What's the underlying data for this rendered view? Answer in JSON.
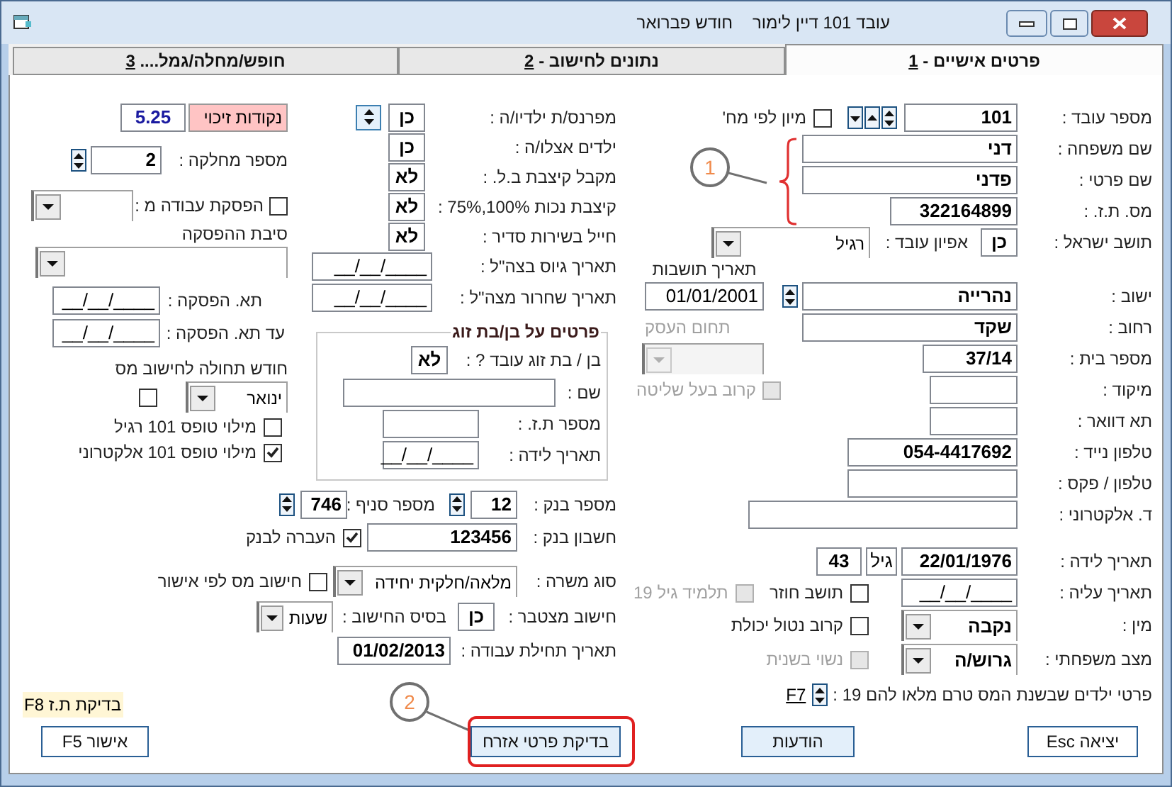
{
  "window": {
    "month": "חודש פברואר",
    "title": "עובד 101 דיין לימור"
  },
  "tabs": [
    {
      "label": "פרטים אישיים - ",
      "hotkey": "1",
      "selected": true
    },
    {
      "label": "נתונים לחישוב - ",
      "hotkey": "2",
      "selected": false
    },
    {
      "label": "חופש/מחלה/גמל.... ",
      "hotkey": "3",
      "selected": false
    }
  ],
  "personal": {
    "employee_number": {
      "label": "מספר עובד :",
      "value": "101"
    },
    "sort_by_department": {
      "label": "מיון לפי מח'",
      "checked": false
    },
    "last_name": {
      "label": "שם משפחה :",
      "value": "דני"
    },
    "first_name": {
      "label": "שם פרטי :",
      "value": "פדני"
    },
    "id_number": {
      "label": "מס. ת.ז. :",
      "value": "322164899"
    },
    "israeli_resident": {
      "label": "תושב ישראל :",
      "value": "כן"
    },
    "employee_type": {
      "label": "אפיון עובד :",
      "value": "רגיל"
    },
    "residence_date": {
      "label": "תאריך תושבות",
      "value": "01/01/2001"
    },
    "city": {
      "label": "ישוב :",
      "value": "נהרייה"
    },
    "street": {
      "label": "רחוב :",
      "value": "שקד"
    },
    "business_field": {
      "label": "תחום העסק",
      "disabled": true
    },
    "house_number": {
      "label": "מספר בית :",
      "value": "37/14"
    },
    "zip": {
      "label": "מיקוד :"
    },
    "controlling_relative": {
      "label": "קרוב בעל שליטה",
      "checked": false,
      "disabled": true
    },
    "po_box": {
      "label": "תא דוואר :"
    },
    "mobile": {
      "label": "טלפון נייד :",
      "value": "054-4417692"
    },
    "phone_fax": {
      "label": "טלפון / פקס :"
    },
    "email": {
      "label": "ד. אלקטרוני :"
    },
    "birth_date": {
      "label": "תאריך לידה :",
      "value": "22/01/1976"
    },
    "age": {
      "label": "גיל",
      "value": "43"
    },
    "immigration_date": {
      "label": "תאריך עליה :",
      "value": "__/__/____"
    },
    "returning_resident": {
      "label": "תושב חוזר",
      "checked": false,
      "disabled": false
    },
    "student_19": {
      "label": "תלמיד גיל 19",
      "checked": false,
      "disabled": true
    },
    "gender": {
      "label": "מין :",
      "value": "נקבה"
    },
    "disabled_relative": {
      "label": "קרוב נטול יכולת",
      "checked": false,
      "disabled": false
    },
    "marital_status": {
      "label": "מצב משפחתי :",
      "value": "גרוש/ה"
    },
    "remarried": {
      "label": "נשוי בשנית",
      "checked": false,
      "disabled": true
    },
    "children": {
      "label": "פרטי ילדים שבשנת המס טרם מלאו להם 19 :",
      "hotkey": "F7"
    }
  },
  "calculation": {
    "provider": {
      "label": "מפרנס/ת ילדיו/ה :",
      "value": "כן"
    },
    "children_with": {
      "label": "ילדים אצלו/ה :",
      "value": "כן"
    },
    "nii_pension": {
      "label": "מקבל קיצבת ב.ל. :",
      "value": "לא"
    },
    "disability": {
      "label": "קיצבת נכות 100%,75% :",
      "value": "לא"
    },
    "soldier": {
      "label": "חייל בשירות סדיר :",
      "value": "לא"
    },
    "draft_date": {
      "label": "תאריך גיוס בצה\"ל :",
      "value": "__/__/____"
    },
    "discharge_date": {
      "label": "תאריך שחרור מצה\"ל :",
      "value": "__/__/____"
    },
    "spouse": {
      "title": "פרטים על בן/בת זוג",
      "works": {
        "label": "בן / בת זוג עובד ? :",
        "value": "לא"
      },
      "name": {
        "label": "שם :"
      },
      "id": {
        "label": "מספר ת.ז. :"
      },
      "birth": {
        "label": "תאריך לידה :",
        "value": "__/__/____"
      }
    },
    "bank": {
      "label": "מספר בנק :",
      "value": "12"
    },
    "branch": {
      "label": "מספר סניף :",
      "value": "746"
    },
    "account": {
      "label": "חשבון בנק :",
      "value": "123456"
    },
    "bank_transfer": {
      "label": "העברה לבנק",
      "checked": true
    },
    "position_type": {
      "label": "סוג משרה :",
      "value": "מלאה/חלקית יחידה"
    },
    "tax_by_approval": {
      "label": "חישוב מס לפי אישור",
      "checked": false
    },
    "cumulative": {
      "label": "חישוב מצטבר :",
      "value": "כן"
    },
    "calc_basis": {
      "label": "בסיס החישוב :",
      "value": "שעות"
    },
    "start_date": {
      "label": "תאריך תחילת עבודה :",
      "value": "01/02/2013"
    }
  },
  "leave": {
    "credit_points": {
      "label": "נקודות זיכוי",
      "value": "5.25"
    },
    "department": {
      "label": "מספר מחלקה :",
      "value": "2"
    },
    "work_stop": {
      "label": "הפסקת עבודה מ :",
      "checked": false
    },
    "stop_reason": {
      "label": "סיבת ההפסקה"
    },
    "stop_date": {
      "label": "תא. הפסקה :",
      "value": "__/__/____"
    },
    "until_stop_date": {
      "label": "עד תא. הפסקה :",
      "value": "__/__/____"
    },
    "tax_month": {
      "label": "חודש תחולה לחישוב מס",
      "value": "ינואר",
      "checked": false
    },
    "form101": [
      {
        "label": "מילוי טופס 101 רגיל",
        "checked": false
      },
      {
        "label": "מילוי טופס 101 אלקטרוני",
        "checked": true
      }
    ],
    "id_check": "בדיקת ת.ז F8"
  },
  "buttons": {
    "exit": "יציאה Esc",
    "messages": "הודעות",
    "citizen_check": "בדיקת פרטי אזרח",
    "approve": "אישור F5"
  },
  "annotations": [
    {
      "label": "1"
    },
    {
      "label": "2"
    }
  ]
}
